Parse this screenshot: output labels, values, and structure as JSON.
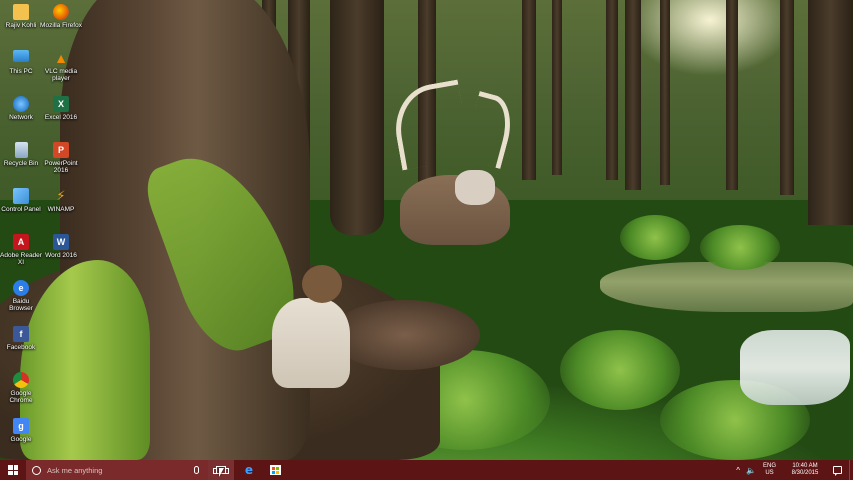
{
  "desktop": {
    "wallpaper": "forest-with-deer-and-child",
    "icons": [
      {
        "label": "Rajiv Kohli",
        "icon": "user-folder-icon",
        "color": "#f2c14e",
        "glyph": ""
      },
      {
        "label": "Mozilla Firefox",
        "icon": "firefox-icon",
        "color": "#e66000",
        "glyph": ""
      },
      {
        "label": "This PC",
        "icon": "computer-icon",
        "color": "#3a9ad9",
        "glyph": ""
      },
      {
        "label": "VLC media player",
        "icon": "vlc-cone-icon",
        "color": "#f08a00",
        "glyph": "▲"
      },
      {
        "label": "Network",
        "icon": "network-globe-icon",
        "color": "#2d7fd0",
        "glyph": ""
      },
      {
        "label": "Excel 2016",
        "icon": "excel-icon",
        "color": "#1e7145",
        "glyph": "X"
      },
      {
        "label": "Recycle Bin",
        "icon": "recycle-bin-icon",
        "color": "#9fb8d0",
        "glyph": ""
      },
      {
        "label": "PowerPoint 2016",
        "icon": "powerpoint-icon",
        "color": "#d24726",
        "glyph": "P"
      },
      {
        "label": "Control Panel",
        "icon": "control-panel-icon",
        "color": "#3c8fd6",
        "glyph": ""
      },
      {
        "label": "WINAMP",
        "icon": "winamp-icon",
        "color": "#e8a60d",
        "glyph": "⚡"
      },
      {
        "label": "Adobe Reader XI",
        "icon": "adobe-reader-icon",
        "color": "#c4161c",
        "glyph": "A"
      },
      {
        "label": "Word 2016",
        "icon": "word-icon",
        "color": "#2b5797",
        "glyph": "W"
      },
      {
        "label": "Baidu Browser",
        "icon": "baidu-browser-icon",
        "color": "#2b7de9",
        "glyph": "e"
      },
      {
        "label": "Facebook",
        "icon": "facebook-icon",
        "color": "#3b5998",
        "glyph": "f"
      },
      {
        "label": "Google Chrome",
        "icon": "chrome-icon",
        "color": "#d93025",
        "glyph": ""
      },
      {
        "label": "Google",
        "icon": "google-icon",
        "color": "#4285f4",
        "glyph": "g"
      }
    ]
  },
  "taskbar": {
    "color": "#5c1414",
    "search_placeholder": "Ask me anything",
    "edge_glyph": "e",
    "tray": {
      "chevron": "^",
      "volume": "🔈",
      "language_top": "ENG",
      "language_bottom": "US",
      "time": "10:40 AM",
      "date": "8/30/2015"
    }
  }
}
